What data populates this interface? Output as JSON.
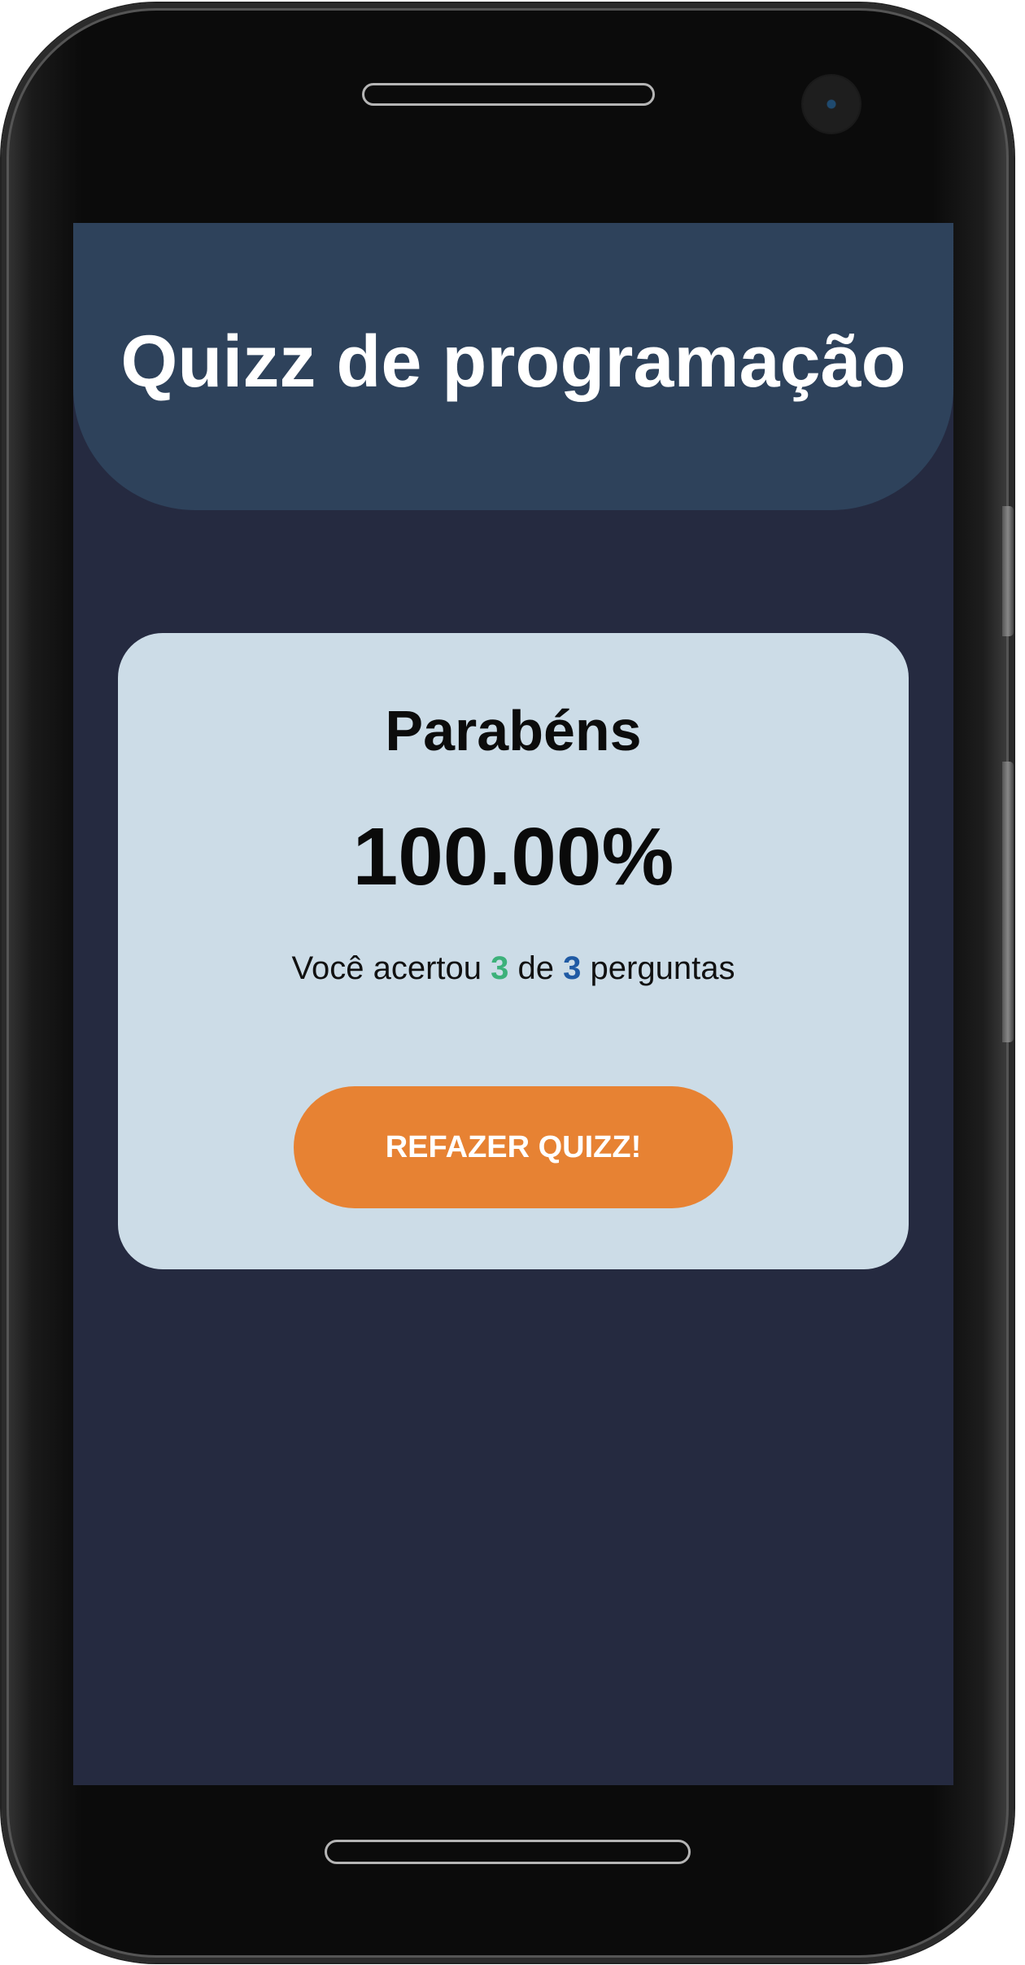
{
  "header": {
    "title": "Quizz de programação"
  },
  "result": {
    "heading": "Parabéns",
    "score": "100.00%",
    "summary_prefix": "Você acertou",
    "correct_count": "3",
    "summary_middle": "de",
    "total_count": "3",
    "summary_suffix": "perguntas",
    "retry_label": "REFAZER QUIZZ!"
  },
  "colors": {
    "screen_background": "#252a40",
    "header_background": "#2e425b",
    "card_background": "#ccdce7",
    "button_background": "#e78233",
    "correct_count": "#3cb17a",
    "total_count": "#1f5aa4"
  }
}
